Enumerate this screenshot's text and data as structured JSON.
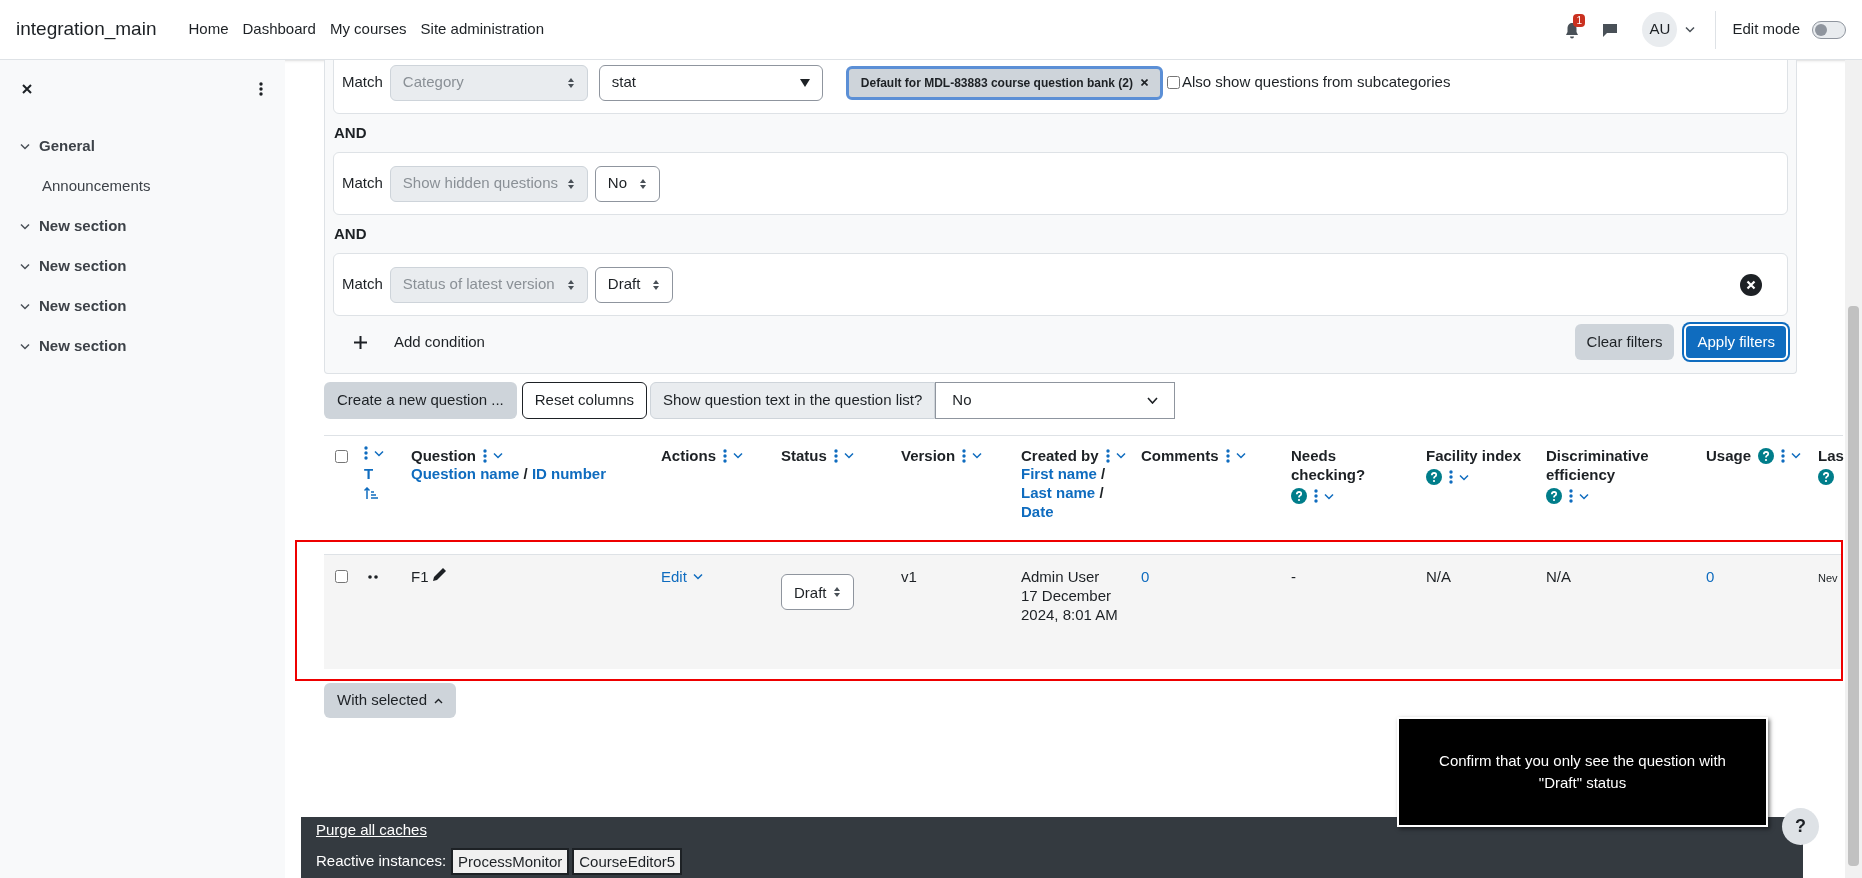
{
  "navbar": {
    "site_name": "integration_main",
    "links": [
      "Home",
      "Dashboard",
      "My courses",
      "Site administration"
    ],
    "notification_count": "1",
    "user_initials": "AU",
    "edit_mode": {
      "label": "Edit mode",
      "on": false
    }
  },
  "sidebar": {
    "sections": [
      {
        "title": "General",
        "expanded": true,
        "children": [
          {
            "title": "Announcements"
          }
        ]
      },
      {
        "title": "New section",
        "expanded": true
      },
      {
        "title": "New section",
        "expanded": true
      },
      {
        "title": "New section",
        "expanded": true
      },
      {
        "title": "New section",
        "expanded": true
      }
    ]
  },
  "filters": {
    "conditions": [
      {
        "kind": "category",
        "label": "Match",
        "field": "Category",
        "value": "stat",
        "chip": "Default for MDL-83883 course question bank (2)",
        "subcategories": {
          "label": "Also show questions from subcategories",
          "checked": false
        },
        "removable": false
      },
      {
        "kind": "select",
        "label": "Match",
        "field": "Show hidden questions",
        "value": "No",
        "removable": false
      },
      {
        "kind": "select",
        "label": "Match",
        "field": "Status of latest version",
        "value": "Draft",
        "removable": true
      }
    ],
    "joiners": [
      "AND",
      "AND"
    ],
    "add_condition": "Add condition",
    "clear_button": "Clear filters",
    "apply_button": "Apply filters"
  },
  "toolbar": {
    "create_button": "Create a new question ...",
    "reset_button": "Reset columns",
    "show_text_label": "Show question text in the question list?",
    "show_text_value": "No"
  },
  "table": {
    "header_checked": false,
    "link_separator": "/",
    "columns": [
      {
        "title": "T",
        "menu": true,
        "sort": true
      },
      {
        "title": "Question",
        "menu": true,
        "links": [
          "Question name",
          "ID number"
        ]
      },
      {
        "title": "Actions",
        "menu": true
      },
      {
        "title": "Status",
        "menu": true
      },
      {
        "title": "Version",
        "menu": true
      },
      {
        "title": "Created by",
        "menu": true,
        "links": [
          "First name",
          "Last name",
          "Date"
        ]
      },
      {
        "title": "Comments",
        "menu": true
      },
      {
        "title": "Needs checking?",
        "help": true,
        "menu": true
      },
      {
        "title": "Facility index",
        "help": true,
        "menu": true
      },
      {
        "title": "Discriminative efficiency",
        "help": true,
        "menu": true
      },
      {
        "title": "Usage",
        "help": true,
        "menu": true
      },
      {
        "title": "Las",
        "help": true
      }
    ],
    "rows": [
      {
        "selected": false,
        "highlighted": true,
        "question": "F1",
        "action": "Edit",
        "status": "Draft",
        "version": "v1",
        "created_by": "Admin User",
        "created_date": "17 December 2024, 8:01 AM",
        "comments": "0",
        "needs_checking": "-",
        "facility_index": "N/A",
        "discriminative_efficiency": "N/A",
        "usage": "0",
        "column_13": "Nev"
      }
    ]
  },
  "with_selected": "With selected",
  "tooltip": "Confirm that you only see the question with \"Draft\" status",
  "help_button": "?",
  "footer": {
    "purge_link": "Purge all caches",
    "reactive_label": "Reactive instances:",
    "reactive_buttons": [
      "ProcessMonitor",
      "CourseEditor5"
    ]
  }
}
